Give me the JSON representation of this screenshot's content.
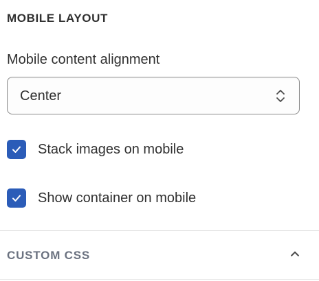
{
  "mobile_layout": {
    "heading": "MOBILE LAYOUT",
    "alignment": {
      "label": "Mobile content alignment",
      "value": "Center",
      "icon": "chevron-up-down-icon"
    },
    "checkboxes": [
      {
        "label": "Stack images on mobile",
        "checked": true
      },
      {
        "label": "Show container on mobile",
        "checked": true
      }
    ]
  },
  "custom_css": {
    "title": "CUSTOM CSS",
    "expanded": true,
    "icon": "chevron-up-icon"
  },
  "colors": {
    "accent": "#2b5cb8",
    "text": "#303030",
    "muted": "#6b7280",
    "divider": "#e3e3e3"
  }
}
